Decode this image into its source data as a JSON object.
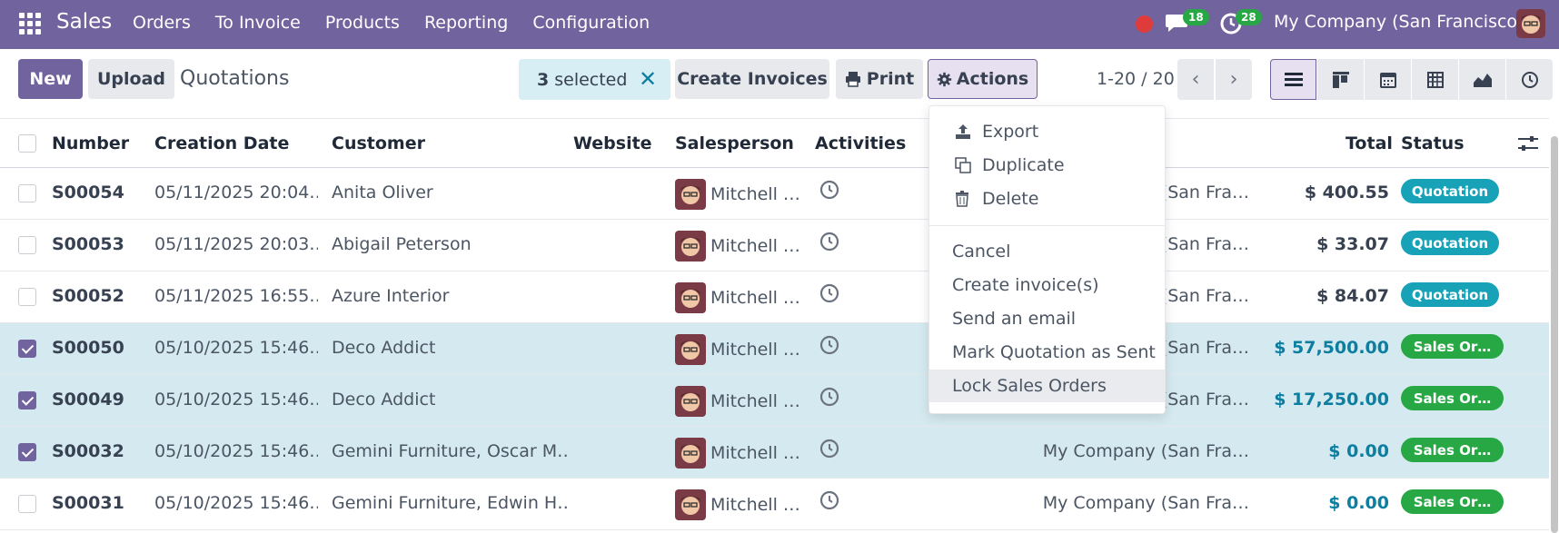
{
  "navbar": {
    "brand": "Sales",
    "menu": [
      "Orders",
      "To Invoice",
      "Products",
      "Reporting",
      "Configuration"
    ],
    "chat_count": "18",
    "activity_count": "28",
    "company": "My Company (San Francisco)",
    "accent": "#71639e"
  },
  "controls": {
    "new_label": "New",
    "upload_label": "Upload",
    "title": "Quotations",
    "selected_count": "3",
    "selected_text": "selected",
    "create_invoices_label": "Create Invoices",
    "print_label": "Print",
    "actions_label": "Actions",
    "pager": "1-20 / 20",
    "views": [
      "list-view-icon",
      "kanban-view-icon",
      "calendar-view-icon",
      "pivot-view-icon",
      "graph-view-icon",
      "activity-view-icon"
    ]
  },
  "table": {
    "headers": {
      "number": "Number",
      "creation_date": "Creation Date",
      "customer": "Customer",
      "website": "Website",
      "salesperson": "Salesperson",
      "activities": "Activities",
      "total": "Total",
      "status": "Status"
    },
    "rows": [
      {
        "number": "S00054",
        "date": "05/11/2025 20:04…",
        "customer": "Anita Oliver",
        "salesperson": "Mitchell …",
        "company": "(San Fra…",
        "total": "$ 400.55",
        "status": "Quotation",
        "selected": false
      },
      {
        "number": "S00053",
        "date": "05/11/2025 20:03…",
        "customer": "Abigail Peterson",
        "salesperson": "Mitchell …",
        "company": "(San Fra…",
        "total": "$ 33.07",
        "status": "Quotation",
        "selected": false
      },
      {
        "number": "S00052",
        "date": "05/11/2025 16:55…",
        "customer": "Azure Interior",
        "salesperson": "Mitchell …",
        "company": "(San Fra…",
        "total": "$ 84.07",
        "status": "Quotation",
        "selected": false
      },
      {
        "number": "S00050",
        "date": "05/10/2025 15:46…",
        "customer": "Deco Addict",
        "salesperson": "Mitchell …",
        "company": "(San Fra…",
        "total": "$ 57,500.00",
        "status": "Sales Or…",
        "selected": true
      },
      {
        "number": "S00049",
        "date": "05/10/2025 15:46…",
        "customer": "Deco Addict",
        "salesperson": "Mitchell …",
        "company": "(San Fra…",
        "total": "$ 17,250.00",
        "status": "Sales Or…",
        "selected": true
      },
      {
        "number": "S00032",
        "date": "05/10/2025 15:46…",
        "customer": "Gemini Furniture, Oscar M…",
        "salesperson": "Mitchell …",
        "company": "My Company (San Fra…",
        "total": "$ 0.00",
        "status": "Sales Or…",
        "selected": true
      },
      {
        "number": "S00031",
        "date": "05/10/2025 15:46…",
        "customer": "Gemini Furniture, Edwin H…",
        "salesperson": "Mitchell …",
        "company": "My Company (San Fra…",
        "total": "$ 0.00",
        "status": "Sales Or…",
        "selected": false
      }
    ]
  },
  "dropdown": {
    "export": "Export",
    "duplicate": "Duplicate",
    "delete": "Delete",
    "cancel": "Cancel",
    "create_invoices": "Create invoice(s)",
    "send_email": "Send an email",
    "mark_sent": "Mark Quotation as Sent",
    "lock_orders": "Lock Sales Orders"
  }
}
